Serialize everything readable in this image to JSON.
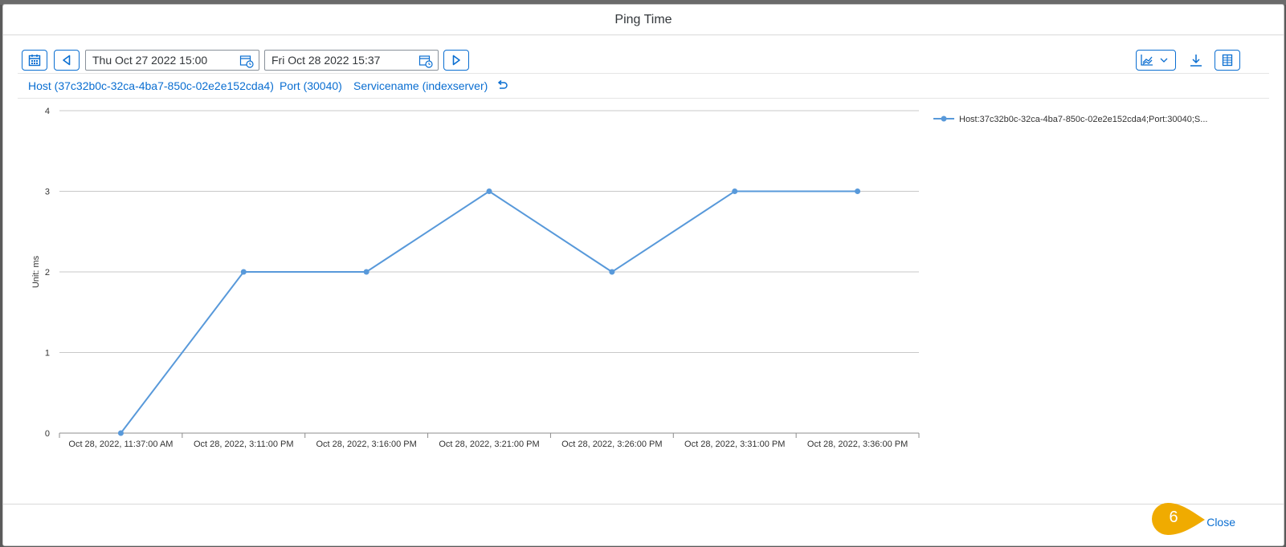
{
  "dialog": {
    "title": "Ping Time"
  },
  "toolbar": {
    "start_date": "Thu Oct 27 2022 15:00",
    "end_date": "Fri Oct 28 2022 15:37",
    "icons": [
      "calendar-icon",
      "previous-icon",
      "next-icon",
      "chart-type-icon",
      "download-icon",
      "table-view-icon"
    ]
  },
  "filters": {
    "host": "Host (37c32b0c-32ca-4ba7-850c-02e2e152cda4)",
    "port": "Port (30040)",
    "service": "Servicename (indexserver)"
  },
  "chart_data": {
    "type": "line",
    "ylabel": "Unit: ms",
    "ylim": [
      0,
      4
    ],
    "yticks": [
      "0",
      "1",
      "2",
      "3",
      "4"
    ],
    "xticks": [
      "Oct 28, 2022, 11:37:00 AM",
      "Oct 28, 2022, 3:11:00 PM",
      "Oct 28, 2022, 3:16:00 PM",
      "Oct 28, 2022, 3:21:00 PM",
      "Oct 28, 2022, 3:26:00 PM",
      "Oct 28, 2022, 3:31:00 PM",
      "Oct 28, 2022, 3:36:00 PM"
    ],
    "grid": true,
    "legend_position": "top-right",
    "series": [
      {
        "name": "Host:37c32b0c-32ca-4ba7-850c-02e2e152cda4;Port:30040;S...",
        "color": "#5899da",
        "values": [
          0,
          2,
          2,
          3,
          2,
          3,
          3
        ]
      }
    ]
  },
  "footer": {
    "close_label": "Close",
    "step_badge": "6",
    "badge_color": "#f0ab00"
  }
}
